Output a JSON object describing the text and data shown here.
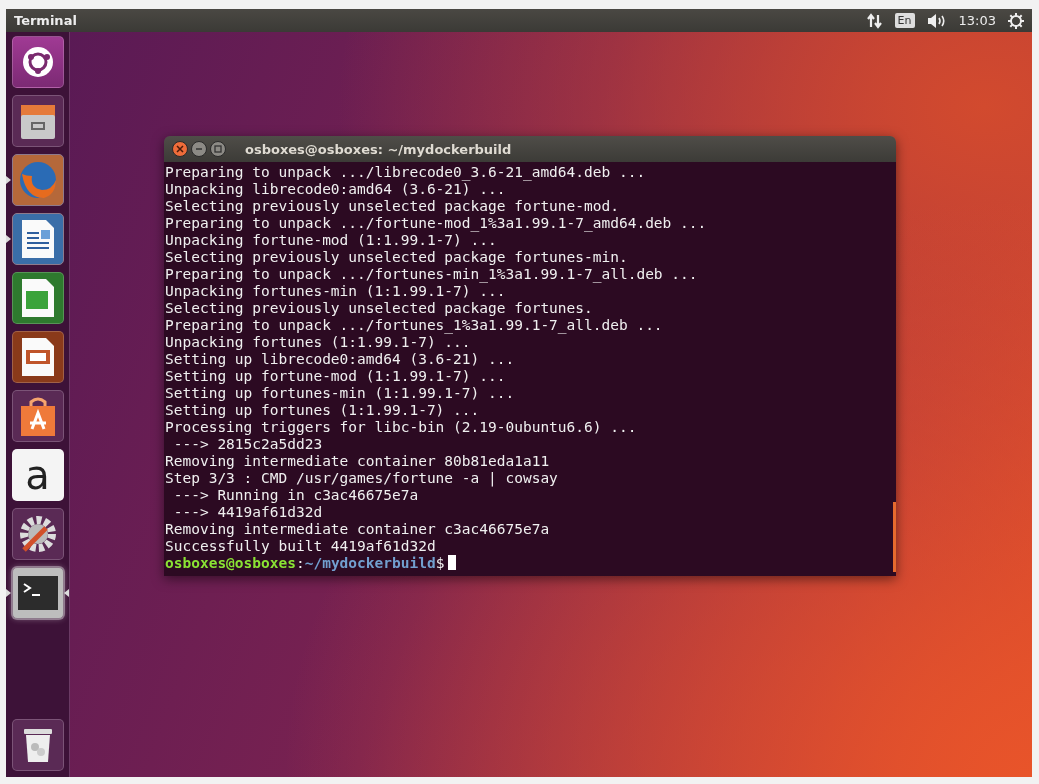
{
  "top_panel": {
    "title": "Terminal",
    "keyboard_layout": "En",
    "clock": "13:03"
  },
  "launcher": [
    {
      "kind": "dash",
      "running": false,
      "focused": false
    },
    {
      "kind": "files",
      "running": false,
      "focused": false
    },
    {
      "kind": "firefox",
      "running": true,
      "focused": false
    },
    {
      "kind": "writer",
      "running": true,
      "focused": false
    },
    {
      "kind": "calc",
      "running": false,
      "focused": false
    },
    {
      "kind": "impress",
      "running": false,
      "focused": false
    },
    {
      "kind": "software",
      "running": false,
      "focused": false
    },
    {
      "kind": "amazon",
      "running": false,
      "focused": false,
      "glyph": "a"
    },
    {
      "kind": "settings",
      "running": false,
      "focused": false
    },
    {
      "kind": "terminal",
      "running": true,
      "focused": true
    }
  ],
  "trash": {
    "kind": "trash"
  },
  "terminal": {
    "title": "osboxes@osboxes: ~/mydockerbuild",
    "lines": [
      "Preparing to unpack .../librecode0_3.6-21_amd64.deb ...",
      "Unpacking librecode0:amd64 (3.6-21) ...",
      "Selecting previously unselected package fortune-mod.",
      "Preparing to unpack .../fortune-mod_1%3a1.99.1-7_amd64.deb ...",
      "Unpacking fortune-mod (1:1.99.1-7) ...",
      "Selecting previously unselected package fortunes-min.",
      "Preparing to unpack .../fortunes-min_1%3a1.99.1-7_all.deb ...",
      "Unpacking fortunes-min (1:1.99.1-7) ...",
      "Selecting previously unselected package fortunes.",
      "Preparing to unpack .../fortunes_1%3a1.99.1-7_all.deb ...",
      "Unpacking fortunes (1:1.99.1-7) ...",
      "Setting up librecode0:amd64 (3.6-21) ...",
      "Setting up fortune-mod (1:1.99.1-7) ...",
      "Setting up fortunes-min (1:1.99.1-7) ...",
      "Setting up fortunes (1:1.99.1-7) ...",
      "Processing triggers for libc-bin (2.19-0ubuntu6.6) ...",
      " ---> 2815c2a5dd23",
      "Removing intermediate container 80b81eda1a11",
      "Step 3/3 : CMD /usr/games/fortune -a | cowsay",
      " ---> Running in c3ac46675e7a",
      " ---> 4419af61d32d",
      "Removing intermediate container c3ac46675e7a",
      "Successfully built 4419af61d32d"
    ],
    "prompt": {
      "user_host": "osboxes@osboxes",
      "separator": ":",
      "path": "~/mydockerbuild",
      "symbol": "$"
    }
  }
}
